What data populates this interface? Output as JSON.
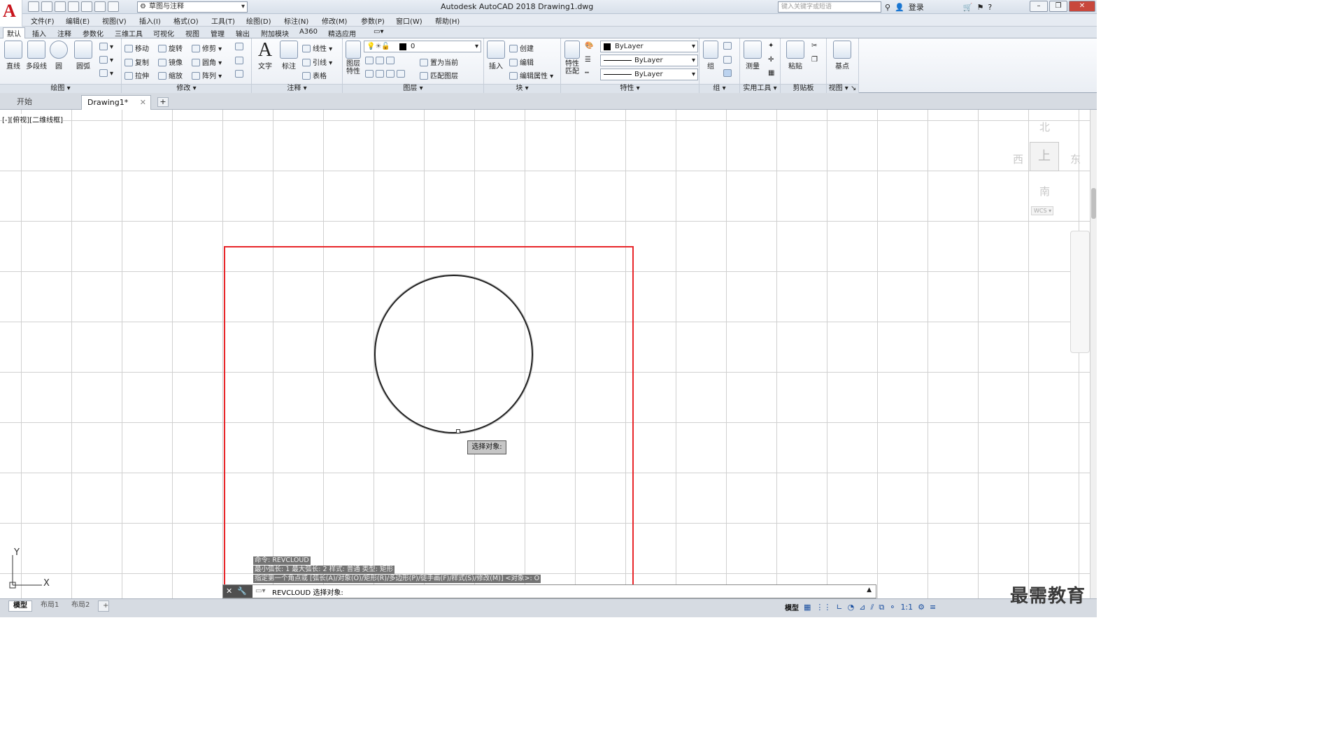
{
  "app": {
    "title": "Autodesk AutoCAD 2018    Drawing1.dwg",
    "logo": "A",
    "workspace": "草图与注释",
    "search_placeholder": "键入关键字或短语",
    "login": "登录",
    "help": "?"
  },
  "menubar": [
    "文件(F)",
    "编辑(E)",
    "视图(V)",
    "插入(I)",
    "格式(O)",
    "工具(T)",
    "绘图(D)",
    "标注(N)",
    "修改(M)",
    "参数(P)",
    "窗口(W)",
    "帮助(H)"
  ],
  "ribbon_tabs": [
    "默认",
    "插入",
    "注释",
    "参数化",
    "三维工具",
    "可视化",
    "视图",
    "管理",
    "输出",
    "附加模块",
    "A360",
    "精选应用"
  ],
  "ribbon": {
    "draw": {
      "title": "绘图",
      "line": "直线",
      "polyline": "多段线",
      "circle": "圆",
      "arc": "圆弧"
    },
    "modify": {
      "title": "修改",
      "move": "移动",
      "rotate": "旋转",
      "trim": "修剪",
      "copy": "复制",
      "mirror": "镜像",
      "fillet": "圆角",
      "stretch": "拉伸",
      "scale": "缩放",
      "array": "阵列"
    },
    "annotation": {
      "title": "注释",
      "text": "文字",
      "dimension": "标注",
      "linear": "线性",
      "leader": "引线",
      "table": "表格"
    },
    "layers": {
      "title": "图层",
      "layer_props": "图层\n特性",
      "current_layer": "0",
      "set_current": "置为当前",
      "match_layer": "匹配图层"
    },
    "block": {
      "title": "块",
      "insert": "插入",
      "create": "创建",
      "edit": "编辑",
      "edit_attr": "编辑属性"
    },
    "properties": {
      "title": "特性",
      "match": "特性\n匹配",
      "color": "ByLayer",
      "linetype": "ByLayer",
      "lineweight": "ByLayer"
    },
    "groups": {
      "title": "组",
      "group": "组"
    },
    "utilities": {
      "title": "实用工具",
      "measure": "测量"
    },
    "clipboard": {
      "title": "剪贴板",
      "paste": "粘贴"
    },
    "view": {
      "title": "视图",
      "base": "基点"
    }
  },
  "doc_tabs": {
    "start": "开始",
    "drawing": "Drawing1*"
  },
  "viewport_label": "[-][俯视][二维线框]",
  "viewcube": {
    "north": "北",
    "south": "南",
    "east": "东",
    "west": "西",
    "wcs": "WCS"
  },
  "ucs": {
    "x": "X",
    "y": "Y"
  },
  "tooltip": "选择对象:",
  "command_history": [
    "命令: REVCLOUD",
    "最小弧长: 1   最大弧长: 2   样式: 普通   类型: 矩形",
    "指定第一个角点或 [弧长(A)/对象(O)/矩形(R)/多边形(P)/徒手画(F)/样式(S)/修改(M)] <对象>: O"
  ],
  "command_line": "REVCLOUD 选择对象:",
  "layout_tabs": [
    "模型",
    "布局1",
    "布局2"
  ],
  "status": {
    "model": "模型",
    "scale": "1:1"
  },
  "watermark": "最需教育",
  "colors": {
    "highlight_red": "#e8262a",
    "grid": "#d0d0d0",
    "accent": "#1a4fa0"
  }
}
